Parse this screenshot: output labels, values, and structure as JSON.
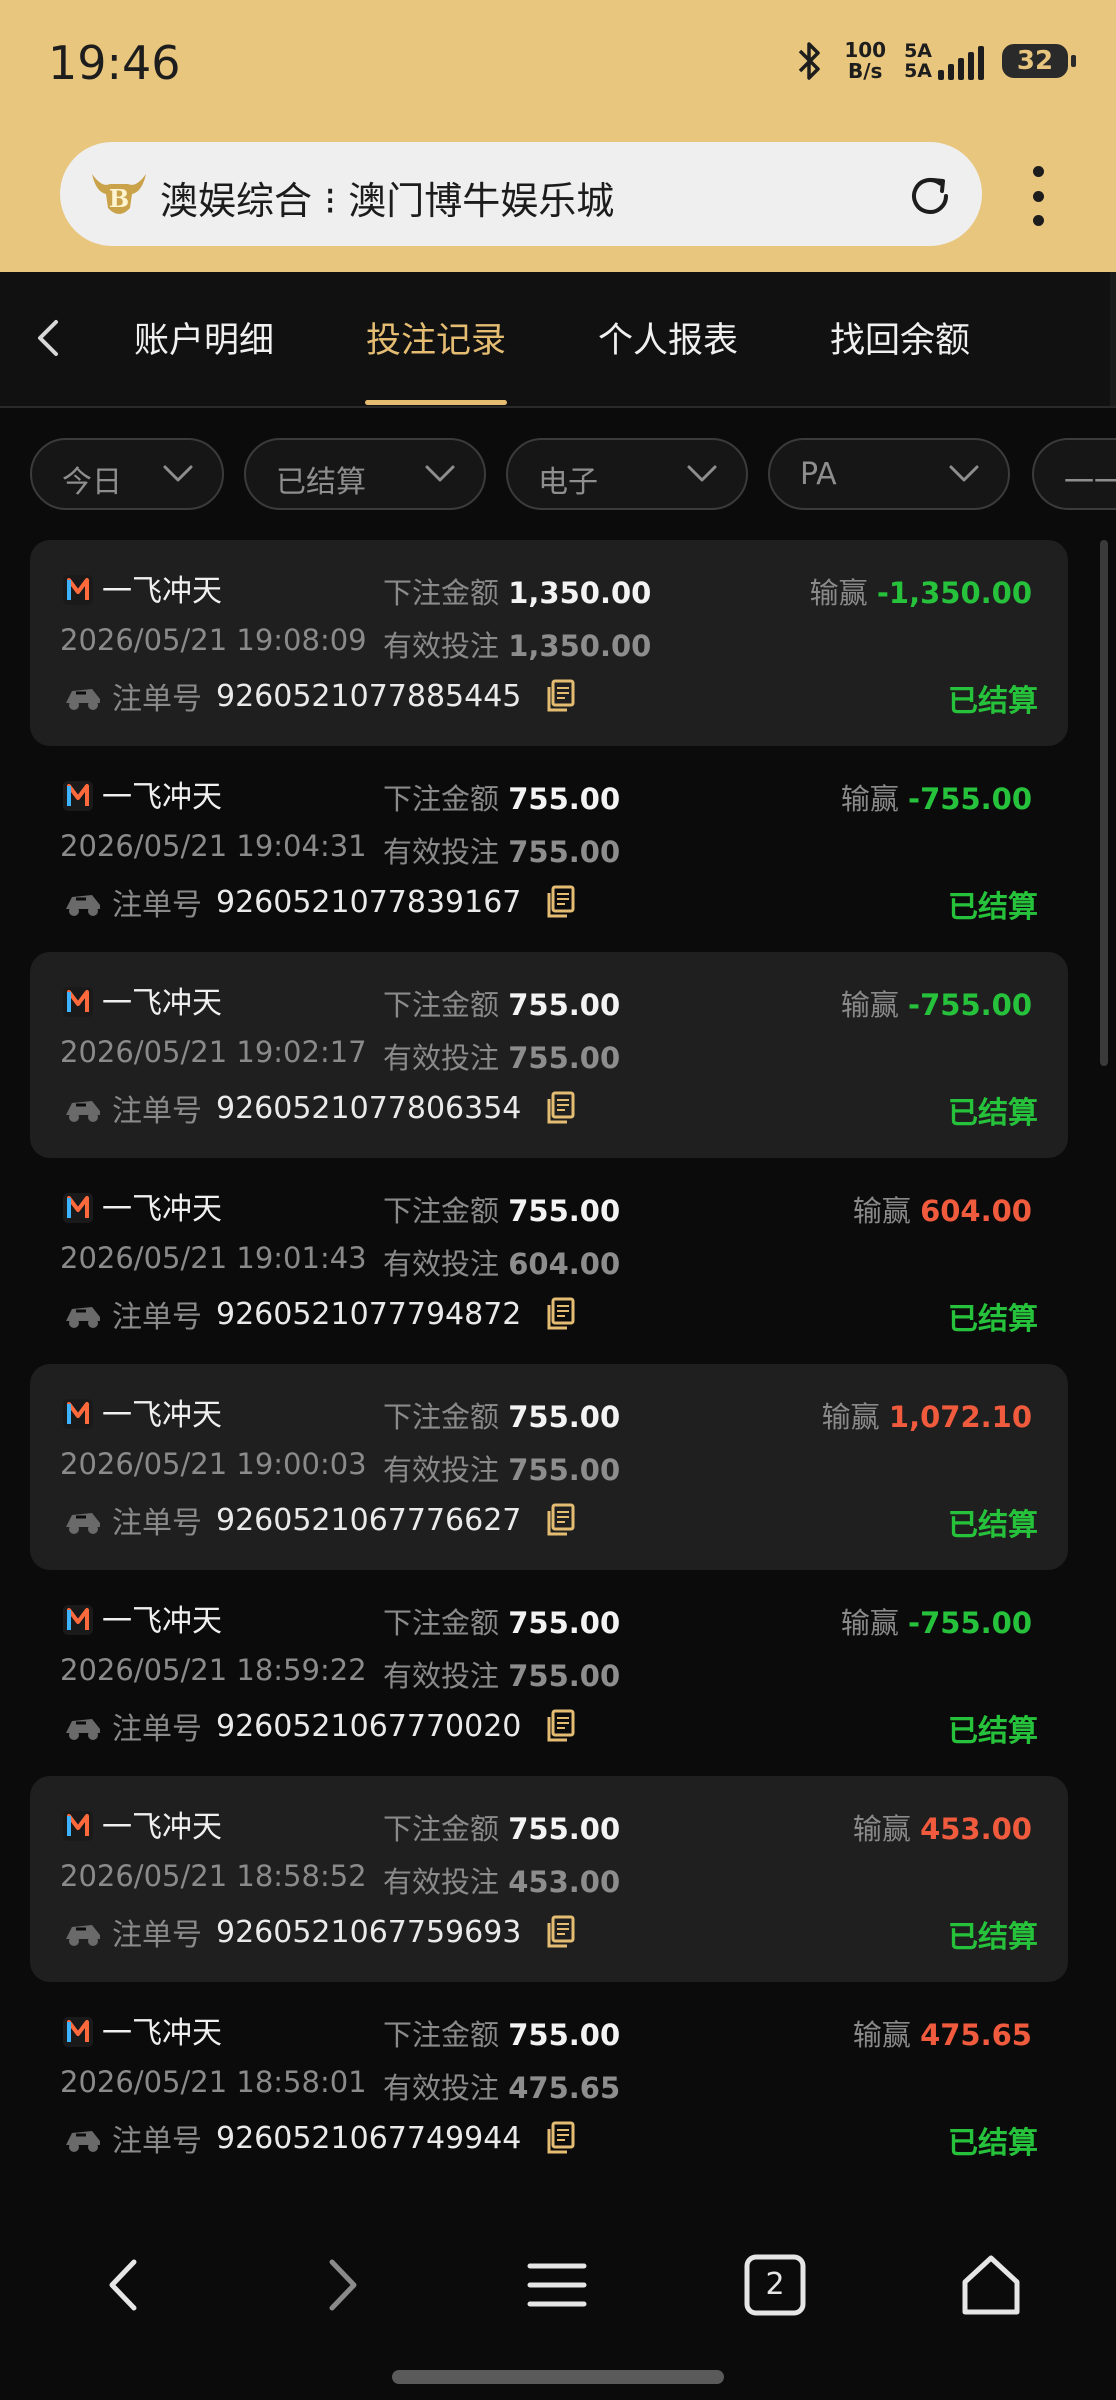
{
  "status_bar": {
    "time": "19:46",
    "net_speed_top": "100",
    "net_speed_bottom": "B/s",
    "signal_label_top": "5A",
    "signal_label_bottom": "5A",
    "battery": "32"
  },
  "browser": {
    "url_title": "澳娱综合 ⁝ 澳门博牛娱乐城",
    "tabs_count": "2"
  },
  "tabs": [
    {
      "label": "账户明细",
      "active": false
    },
    {
      "label": "投注记录",
      "active": true
    },
    {
      "label": "个人报表",
      "active": false
    },
    {
      "label": "找回余额",
      "active": false
    }
  ],
  "filters": [
    {
      "label": "今日"
    },
    {
      "label": "已结算"
    },
    {
      "label": "电子"
    },
    {
      "label": "PA"
    },
    {
      "label": "一一"
    }
  ],
  "labels": {
    "bet_amount": "下注金额",
    "valid_bet": "有效投注",
    "win_loss": "输赢",
    "bill_no": "注单号"
  },
  "colors": {
    "accent": "#e4bd73",
    "loss": "#27c23b",
    "win": "#f05a3d"
  },
  "records": [
    {
      "game": "一飞冲天",
      "amount": "1,350.00",
      "valid": "1,350.00",
      "winloss": "-1,350.00",
      "negative": true,
      "datetime": "2026/05/21 19:08:09",
      "bill": "9260521077885445",
      "status": "已结算"
    },
    {
      "game": "一飞冲天",
      "amount": "755.00",
      "valid": "755.00",
      "winloss": "-755.00",
      "negative": true,
      "datetime": "2026/05/21 19:04:31",
      "bill": "9260521077839167",
      "status": "已结算"
    },
    {
      "game": "一飞冲天",
      "amount": "755.00",
      "valid": "755.00",
      "winloss": "-755.00",
      "negative": true,
      "datetime": "2026/05/21 19:02:17",
      "bill": "9260521077806354",
      "status": "已结算"
    },
    {
      "game": "一飞冲天",
      "amount": "755.00",
      "valid": "604.00",
      "winloss": "604.00",
      "negative": false,
      "datetime": "2026/05/21 19:01:43",
      "bill": "9260521077794872",
      "status": "已结算"
    },
    {
      "game": "一飞冲天",
      "amount": "755.00",
      "valid": "755.00",
      "winloss": "1,072.10",
      "negative": false,
      "datetime": "2026/05/21 19:00:03",
      "bill": "9260521067776627",
      "status": "已结算"
    },
    {
      "game": "一飞冲天",
      "amount": "755.00",
      "valid": "755.00",
      "winloss": "-755.00",
      "negative": true,
      "datetime": "2026/05/21 18:59:22",
      "bill": "9260521067770020",
      "status": "已结算"
    },
    {
      "game": "一飞冲天",
      "amount": "755.00",
      "valid": "453.00",
      "winloss": "453.00",
      "negative": false,
      "datetime": "2026/05/21 18:58:52",
      "bill": "9260521067759693",
      "status": "已结算"
    },
    {
      "game": "一飞冲天",
      "amount": "755.00",
      "valid": "475.65",
      "winloss": "475.65",
      "negative": false,
      "datetime": "2026/05/21 18:58:01",
      "bill": "9260521067749944",
      "status": "已结算"
    }
  ],
  "nav": {
    "back_icon": "arrow-left-icon",
    "forward_icon": "arrow-right-icon",
    "menu_icon": "menu-icon",
    "tabs_icon": "tabs-icon",
    "home_icon": "home-icon"
  }
}
